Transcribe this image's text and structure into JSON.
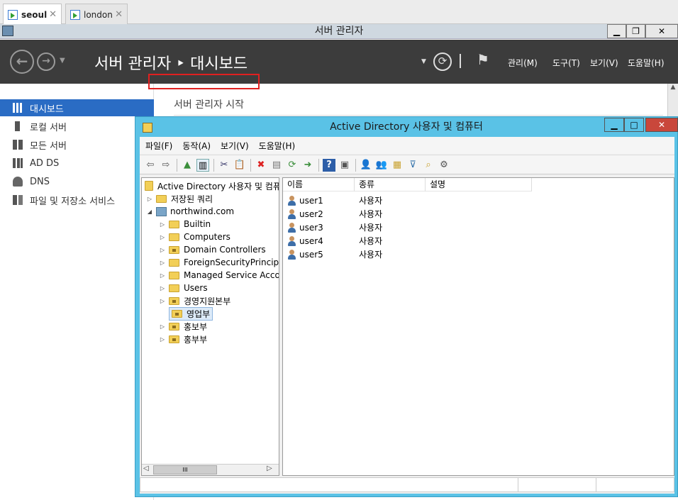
{
  "rdp_tabs": [
    {
      "label": "seoul",
      "close": "✕"
    },
    {
      "label": "london",
      "close": "✕"
    }
  ],
  "window": {
    "title": "서버 관리자",
    "minimize": "▁",
    "restore": "❐",
    "close": "✕"
  },
  "header": {
    "breadcrumb": "서버 관리자 ‣ 대시보드",
    "menus": [
      "관리(M)",
      "도구(T)",
      "보기(V)",
      "도움말(H)"
    ]
  },
  "sidebar": {
    "items": [
      {
        "label": "대시보드",
        "icon": "dashboard-icon"
      },
      {
        "label": "로컬 서버",
        "icon": "server-icon"
      },
      {
        "label": "모든 서버",
        "icon": "servers-icon"
      },
      {
        "label": "AD DS",
        "icon": "ad-ds-icon"
      },
      {
        "label": "DNS",
        "icon": "dns-icon"
      },
      {
        "label": "파일 및 저장소 서비스",
        "icon": "file-storage-icon"
      }
    ]
  },
  "content": {
    "welcome": "서버 관리자 시작"
  },
  "ad_window": {
    "title": "Active Directory 사용자 및 컴퓨터",
    "menu": [
      "파일(F)",
      "동작(A)",
      "보기(V)",
      "도움말(H)"
    ],
    "tree": {
      "root": "Active Directory 사용자 및 컴퓨터",
      "saved_queries": "저장된 쿼리",
      "domain": "northwind.com",
      "children": [
        "Builtin",
        "Computers",
        "Domain Controllers",
        "ForeignSecurityPrincipals",
        "Managed Service Accounts",
        "Users",
        "경영지원본부",
        "영업부",
        "홍보부",
        "홍부부"
      ],
      "selected": "영업부"
    },
    "columns": [
      "이름",
      "종류",
      "설명"
    ],
    "rows": [
      {
        "name": "user1",
        "type": "사용자"
      },
      {
        "name": "user2",
        "type": "사용자"
      },
      {
        "name": "user3",
        "type": "사용자"
      },
      {
        "name": "user4",
        "type": "사용자"
      },
      {
        "name": "user5",
        "type": "사용자"
      }
    ],
    "scroll_thumb": "III"
  },
  "colors": {
    "accent_blue": "#2a6cc4",
    "ad_title_bar": "#5ac2e6",
    "header_bg": "#3c3c3c",
    "highlight": "#e02020"
  }
}
